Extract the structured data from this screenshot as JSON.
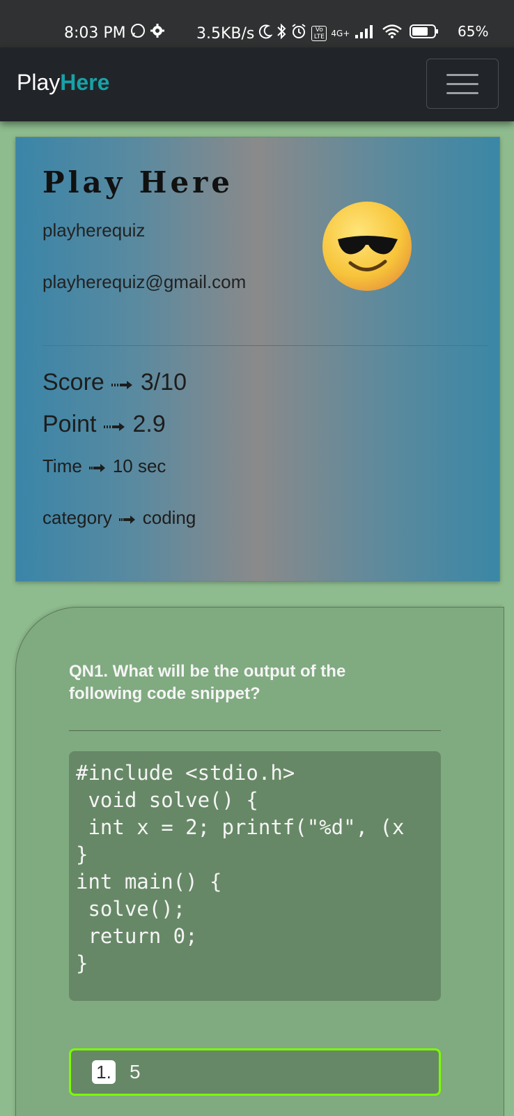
{
  "status_bar": {
    "time": "8:03 PM",
    "net_speed": "3.5KB/s",
    "network_label": "4G+",
    "volte_label": "Vo LTE",
    "battery_percent": "65%",
    "icons": [
      "whatsapp-icon",
      "settings-icon",
      "moon-icon",
      "bluetooth-icon",
      "alarm-icon",
      "signal-icon",
      "wifi-icon",
      "battery-icon"
    ]
  },
  "navbar": {
    "brand_main": "Play",
    "brand_accent": "Here",
    "brand_accent_color": "#17a2a8",
    "background_color": "#212529"
  },
  "profile": {
    "title": "Play Here",
    "username": "playherequiz",
    "email": "playherequiz@gmail.com",
    "avatar_icon": "sunglasses-emoji",
    "stats": {
      "score_label": "Score",
      "score_value": "3/10",
      "point_label": "Point",
      "point_value": "2.9",
      "time_label": "Time",
      "time_value": "10 sec",
      "category_label": "category",
      "category_value": "coding"
    }
  },
  "question": {
    "text": "QN1. What will be the output of the following code snippet?",
    "code_lines": [
      "#include <stdio.h>",
      " void solve() {",
      " int x = 2; printf(\"%d\", (x",
      "}",
      "int main() {",
      " solve();",
      " return 0;",
      "}"
    ],
    "options": [
      {
        "number": "1.",
        "text": "5",
        "selected_color": "#7cfc00"
      }
    ]
  },
  "colors": {
    "page_background": "#8fbc8f",
    "question_card": "#80aa80",
    "code_background": "#668866"
  }
}
